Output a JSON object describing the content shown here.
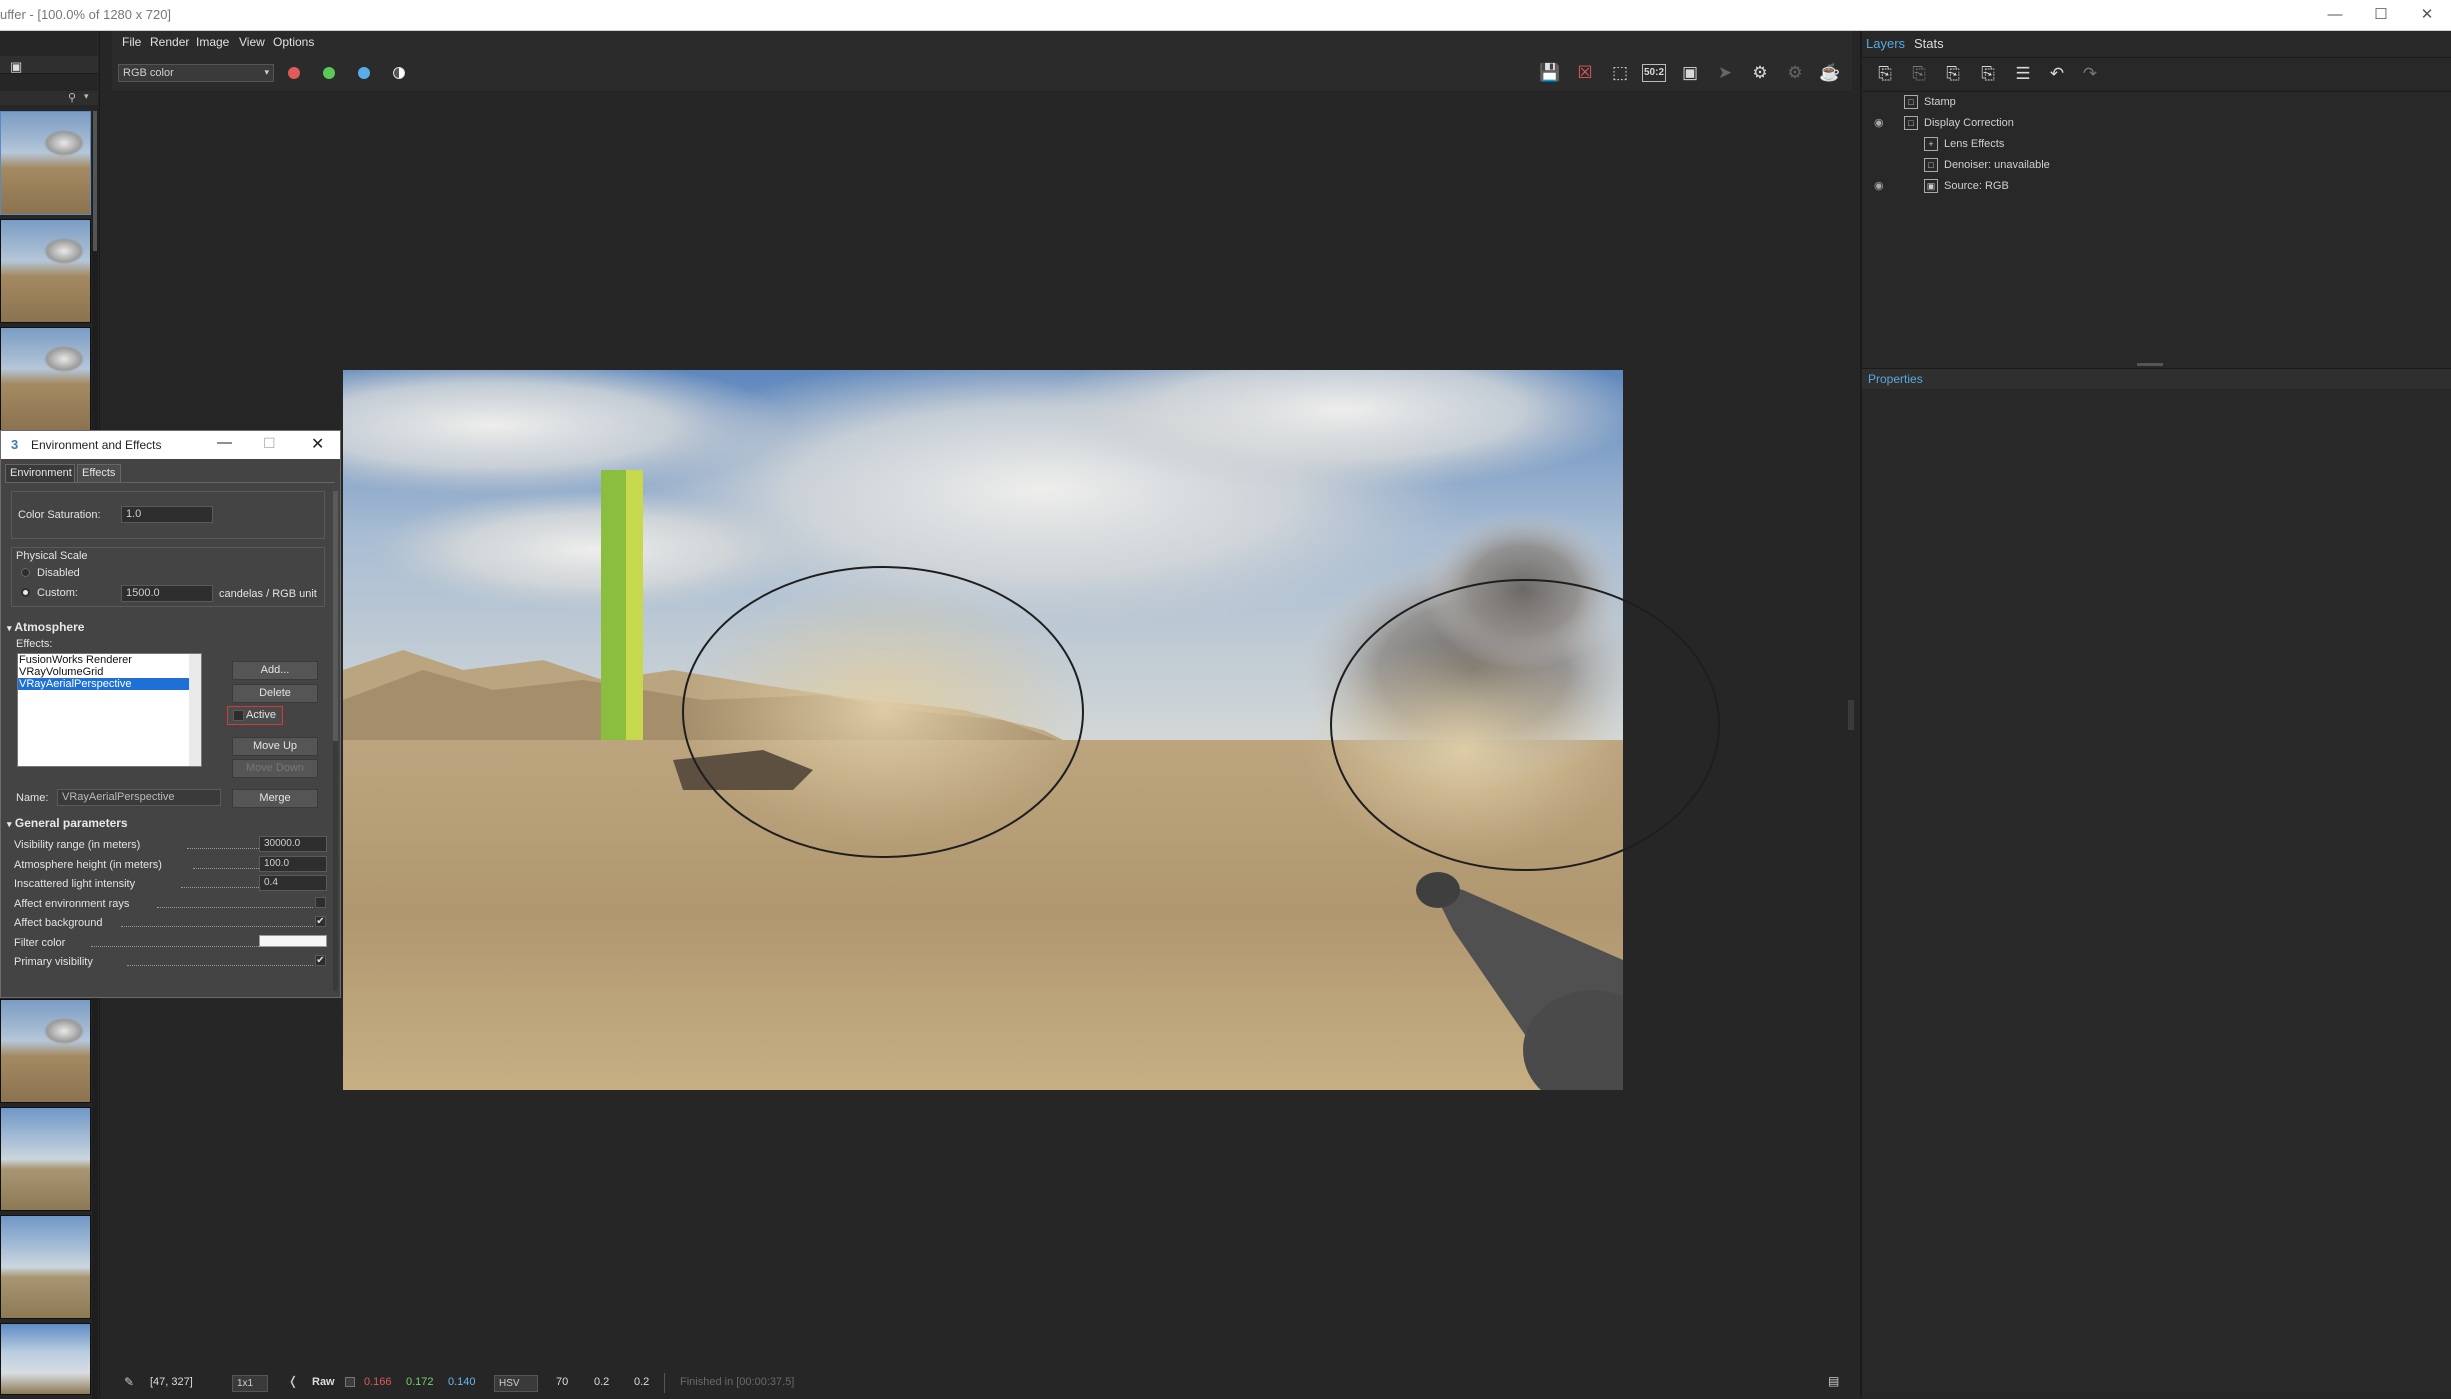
{
  "window": {
    "title": "uffer - [100.0% of 1280 x 720]",
    "controls": [
      "minimize-icon",
      "maximize-icon",
      "close-icon"
    ]
  },
  "menu": [
    "File",
    "Render",
    "Image",
    "View",
    "Options"
  ],
  "toolbar": {
    "channel_select": "RGB color",
    "channel_dots": [
      "#e05a5a",
      "#5ac85a",
      "#5aaee8"
    ],
    "zoom_badge": "50:2"
  },
  "right_panel": {
    "tabs": [
      "Layers",
      "Stats"
    ],
    "layers": [
      {
        "name": "Stamp",
        "visible": false,
        "indent": 0
      },
      {
        "name": "Display Correction",
        "visible": true,
        "indent": 0
      },
      {
        "name": "Lens Effects",
        "visible": false,
        "indent": 1
      },
      {
        "name": "Denoiser: unavailable",
        "visible": false,
        "indent": 1
      },
      {
        "name": "Source: RGB",
        "visible": true,
        "indent": 1
      }
    ],
    "properties_label": "Properties"
  },
  "dialog": {
    "title": "Environment and Effects",
    "tabs": [
      "Environment",
      "Effects"
    ],
    "color_saturation_label": "Color Saturation:",
    "color_saturation_value": "1.0",
    "physical_scale_label": "Physical Scale",
    "disabled_label": "Disabled",
    "custom_label": "Custom:",
    "custom_value": "1500.0",
    "custom_unit": "candelas / RGB unit",
    "atmosphere_header": "Atmosphere",
    "effects_label": "Effects:",
    "effects_list": [
      "FusionWorks Renderer",
      "VRayVolumeGrid",
      "VRayAerialPerspective"
    ],
    "selected_effect_index": 2,
    "buttons": {
      "add": "Add...",
      "delete": "Delete",
      "active": "Active",
      "move_up": "Move Up",
      "move_down": "Move Down",
      "merge": "Merge"
    },
    "name_label": "Name:",
    "name_value": "VRayAerialPerspective",
    "general_header": "General parameters",
    "params": [
      {
        "label": "Visibility range (in meters)",
        "value": "30000.0",
        "kind": "spinner"
      },
      {
        "label": "Atmosphere height (in meters)",
        "value": "100.0",
        "kind": "spinner"
      },
      {
        "label": "Inscattered light intensity",
        "value": "0.4",
        "kind": "spinner"
      },
      {
        "label": "Affect environment rays",
        "value": "",
        "kind": "check",
        "checked": false
      },
      {
        "label": "Affect background",
        "value": "",
        "kind": "check",
        "checked": true
      },
      {
        "label": "Filter color",
        "value": "",
        "kind": "color"
      },
      {
        "label": "Primary visibility",
        "value": "",
        "kind": "check",
        "checked": true
      }
    ]
  },
  "status": {
    "coords": "[47, 327]",
    "zoom": "1x1",
    "raw_label": "Raw",
    "r": "0.166",
    "g": "0.172",
    "b": "0.140",
    "colorspace": "HSV",
    "h": "70",
    "s": "0.2",
    "v": "0.2",
    "message": "Finished in [00:00:37.5]"
  }
}
